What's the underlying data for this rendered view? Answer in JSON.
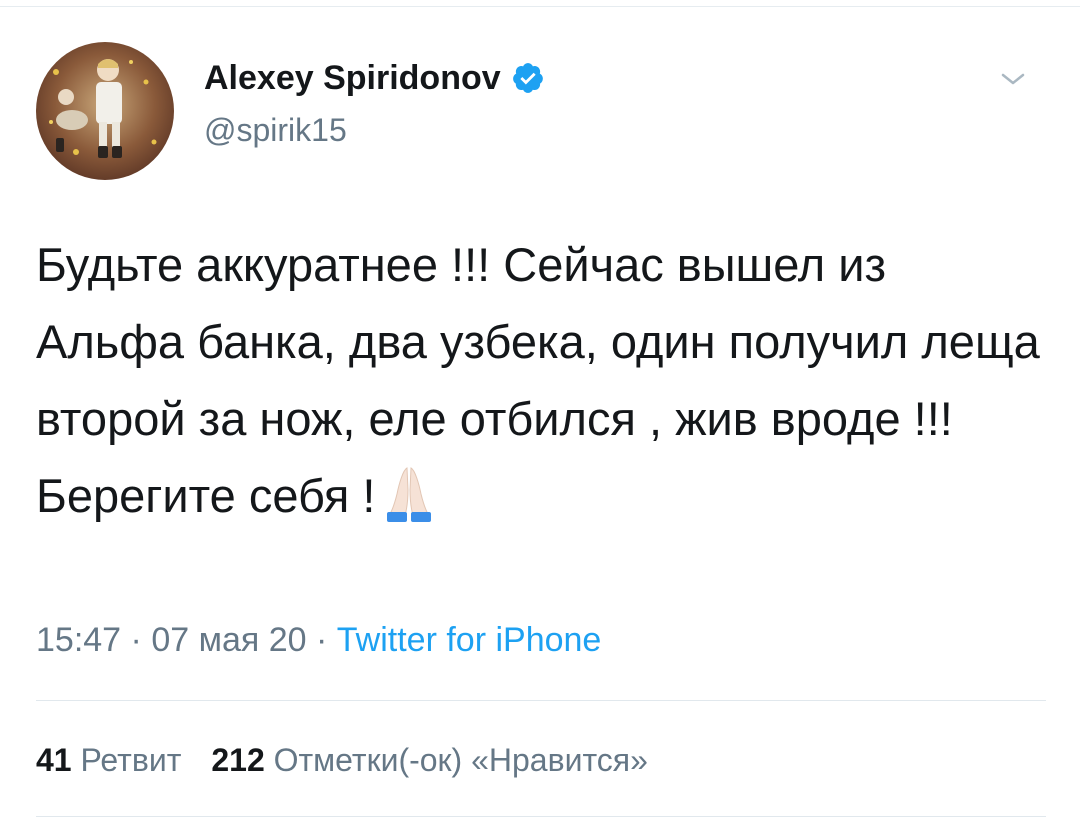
{
  "author": {
    "name": "Alexey Spiridonov",
    "handle": "@spirik15",
    "verified": true
  },
  "tweet": {
    "text": "Будьте аккуратнее !!! Сейчас вышел из Альфа банка, два узбека, один получил леща второй за нож, еле отбился , жив вроде !!! Берегите себя !",
    "emoji": "folded-hands-icon"
  },
  "meta": {
    "time": "15:47",
    "separator": " · ",
    "date": "07 мая 20",
    "source": "Twitter for iPhone"
  },
  "stats": {
    "retweets_count": "41",
    "retweets_label": "Ретвит",
    "likes_count": "212",
    "likes_label": "Отметки(-ок) «Нравится»"
  },
  "colors": {
    "text": "#14171a",
    "secondary": "#657786",
    "accent": "#1da1f2",
    "divider": "#e1e8ed"
  }
}
